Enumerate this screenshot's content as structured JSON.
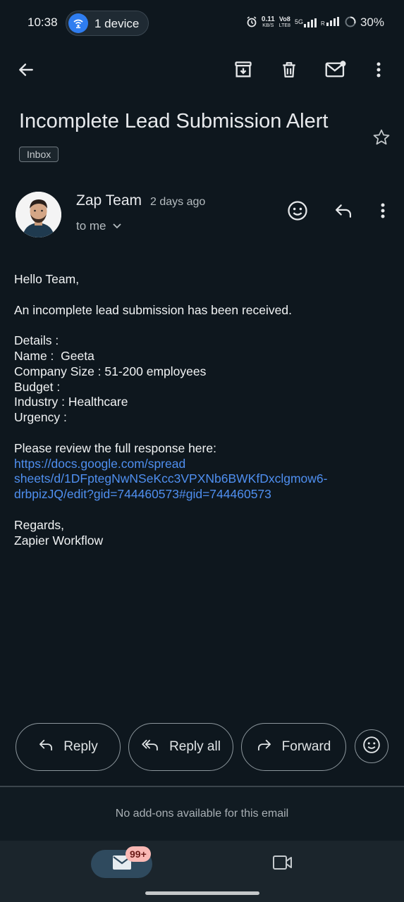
{
  "status_bar": {
    "time": "10:38",
    "device_pill": "1 device",
    "net_speed_top": "0.11",
    "net_speed_bottom": "KB/S",
    "volte_top": "Vo8",
    "volte_bottom": "LTE8",
    "signal_label": "5G",
    "battery": "30%"
  },
  "toolbar": {
    "back": "back-arrow-icon",
    "archive": "archive-icon",
    "delete": "trash-icon",
    "mark_unread": "mail-unread-icon",
    "more": "more-vert-icon"
  },
  "email": {
    "subject": "Incomplete Lead Submission Alert",
    "label": "Inbox",
    "sender": "Zap Team",
    "time": "2 days ago",
    "recipient": "to me",
    "body": {
      "greeting": "Hello Team,",
      "intro": "An incomplete lead submission has been received.",
      "details_header": "Details :",
      "name": "Name :  Geeta",
      "company_size": "Company Size : 51-200 employees",
      "budget": "Budget :",
      "industry": "Industry : Healthcare",
      "urgency": "Urgency :",
      "review_text": "Please review the full response here:",
      "link_line1": "https://docs.google.com/spread",
      "link_line2": "sheets/d/1DFptegNwNSeKcc3VPXNb6BWKfDxclgmow6-",
      "link_line3": "drbpizJQ/edit?gid=744460573#gid=744460573",
      "regards": "Regards,",
      "signature": "Zapier Workflow"
    }
  },
  "actions": {
    "reply": "Reply",
    "reply_all": "Reply all",
    "forward": "Forward"
  },
  "addons_text": "No add-ons available for this email",
  "bottom_nav": {
    "mail_badge": "99+"
  },
  "colors": {
    "background": "#0e171e",
    "link": "#4f8ff0",
    "badge": "#f9b8b4",
    "accent_pill": "#2f7df0"
  }
}
